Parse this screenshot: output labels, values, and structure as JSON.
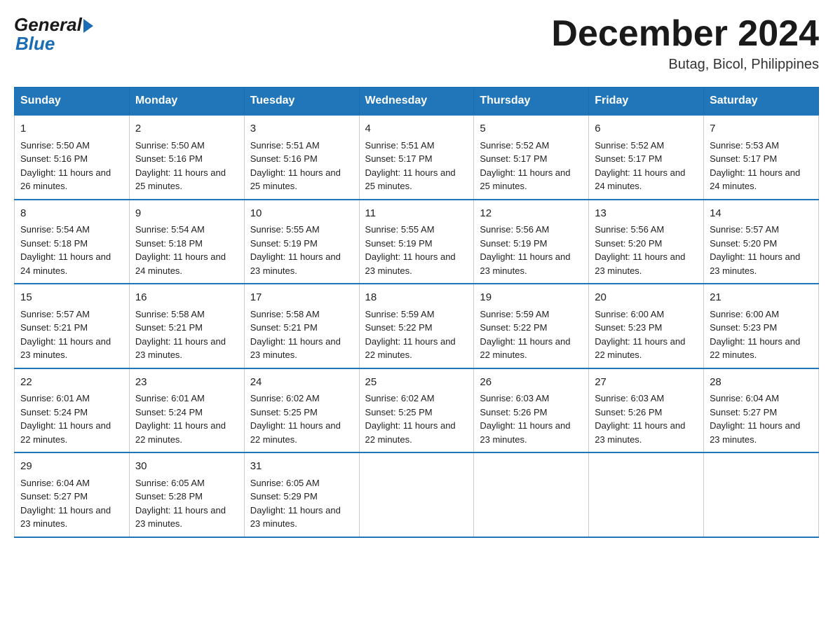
{
  "logo": {
    "general": "General",
    "blue": "Blue"
  },
  "title": "December 2024",
  "subtitle": "Butag, Bicol, Philippines",
  "days": [
    "Sunday",
    "Monday",
    "Tuesday",
    "Wednesday",
    "Thursday",
    "Friday",
    "Saturday"
  ],
  "weeks": [
    [
      {
        "day": "1",
        "sunrise": "5:50 AM",
        "sunset": "5:16 PM",
        "daylight": "11 hours and 26 minutes."
      },
      {
        "day": "2",
        "sunrise": "5:50 AM",
        "sunset": "5:16 PM",
        "daylight": "11 hours and 25 minutes."
      },
      {
        "day": "3",
        "sunrise": "5:51 AM",
        "sunset": "5:16 PM",
        "daylight": "11 hours and 25 minutes."
      },
      {
        "day": "4",
        "sunrise": "5:51 AM",
        "sunset": "5:17 PM",
        "daylight": "11 hours and 25 minutes."
      },
      {
        "day": "5",
        "sunrise": "5:52 AM",
        "sunset": "5:17 PM",
        "daylight": "11 hours and 25 minutes."
      },
      {
        "day": "6",
        "sunrise": "5:52 AM",
        "sunset": "5:17 PM",
        "daylight": "11 hours and 24 minutes."
      },
      {
        "day": "7",
        "sunrise": "5:53 AM",
        "sunset": "5:17 PM",
        "daylight": "11 hours and 24 minutes."
      }
    ],
    [
      {
        "day": "8",
        "sunrise": "5:54 AM",
        "sunset": "5:18 PM",
        "daylight": "11 hours and 24 minutes."
      },
      {
        "day": "9",
        "sunrise": "5:54 AM",
        "sunset": "5:18 PM",
        "daylight": "11 hours and 24 minutes."
      },
      {
        "day": "10",
        "sunrise": "5:55 AM",
        "sunset": "5:19 PM",
        "daylight": "11 hours and 23 minutes."
      },
      {
        "day": "11",
        "sunrise": "5:55 AM",
        "sunset": "5:19 PM",
        "daylight": "11 hours and 23 minutes."
      },
      {
        "day": "12",
        "sunrise": "5:56 AM",
        "sunset": "5:19 PM",
        "daylight": "11 hours and 23 minutes."
      },
      {
        "day": "13",
        "sunrise": "5:56 AM",
        "sunset": "5:20 PM",
        "daylight": "11 hours and 23 minutes."
      },
      {
        "day": "14",
        "sunrise": "5:57 AM",
        "sunset": "5:20 PM",
        "daylight": "11 hours and 23 minutes."
      }
    ],
    [
      {
        "day": "15",
        "sunrise": "5:57 AM",
        "sunset": "5:21 PM",
        "daylight": "11 hours and 23 minutes."
      },
      {
        "day": "16",
        "sunrise": "5:58 AM",
        "sunset": "5:21 PM",
        "daylight": "11 hours and 23 minutes."
      },
      {
        "day": "17",
        "sunrise": "5:58 AM",
        "sunset": "5:21 PM",
        "daylight": "11 hours and 23 minutes."
      },
      {
        "day": "18",
        "sunrise": "5:59 AM",
        "sunset": "5:22 PM",
        "daylight": "11 hours and 22 minutes."
      },
      {
        "day": "19",
        "sunrise": "5:59 AM",
        "sunset": "5:22 PM",
        "daylight": "11 hours and 22 minutes."
      },
      {
        "day": "20",
        "sunrise": "6:00 AM",
        "sunset": "5:23 PM",
        "daylight": "11 hours and 22 minutes."
      },
      {
        "day": "21",
        "sunrise": "6:00 AM",
        "sunset": "5:23 PM",
        "daylight": "11 hours and 22 minutes."
      }
    ],
    [
      {
        "day": "22",
        "sunrise": "6:01 AM",
        "sunset": "5:24 PM",
        "daylight": "11 hours and 22 minutes."
      },
      {
        "day": "23",
        "sunrise": "6:01 AM",
        "sunset": "5:24 PM",
        "daylight": "11 hours and 22 minutes."
      },
      {
        "day": "24",
        "sunrise": "6:02 AM",
        "sunset": "5:25 PM",
        "daylight": "11 hours and 22 minutes."
      },
      {
        "day": "25",
        "sunrise": "6:02 AM",
        "sunset": "5:25 PM",
        "daylight": "11 hours and 22 minutes."
      },
      {
        "day": "26",
        "sunrise": "6:03 AM",
        "sunset": "5:26 PM",
        "daylight": "11 hours and 23 minutes."
      },
      {
        "day": "27",
        "sunrise": "6:03 AM",
        "sunset": "5:26 PM",
        "daylight": "11 hours and 23 minutes."
      },
      {
        "day": "28",
        "sunrise": "6:04 AM",
        "sunset": "5:27 PM",
        "daylight": "11 hours and 23 minutes."
      }
    ],
    [
      {
        "day": "29",
        "sunrise": "6:04 AM",
        "sunset": "5:27 PM",
        "daylight": "11 hours and 23 minutes."
      },
      {
        "day": "30",
        "sunrise": "6:05 AM",
        "sunset": "5:28 PM",
        "daylight": "11 hours and 23 minutes."
      },
      {
        "day": "31",
        "sunrise": "6:05 AM",
        "sunset": "5:29 PM",
        "daylight": "11 hours and 23 minutes."
      },
      null,
      null,
      null,
      null
    ]
  ]
}
